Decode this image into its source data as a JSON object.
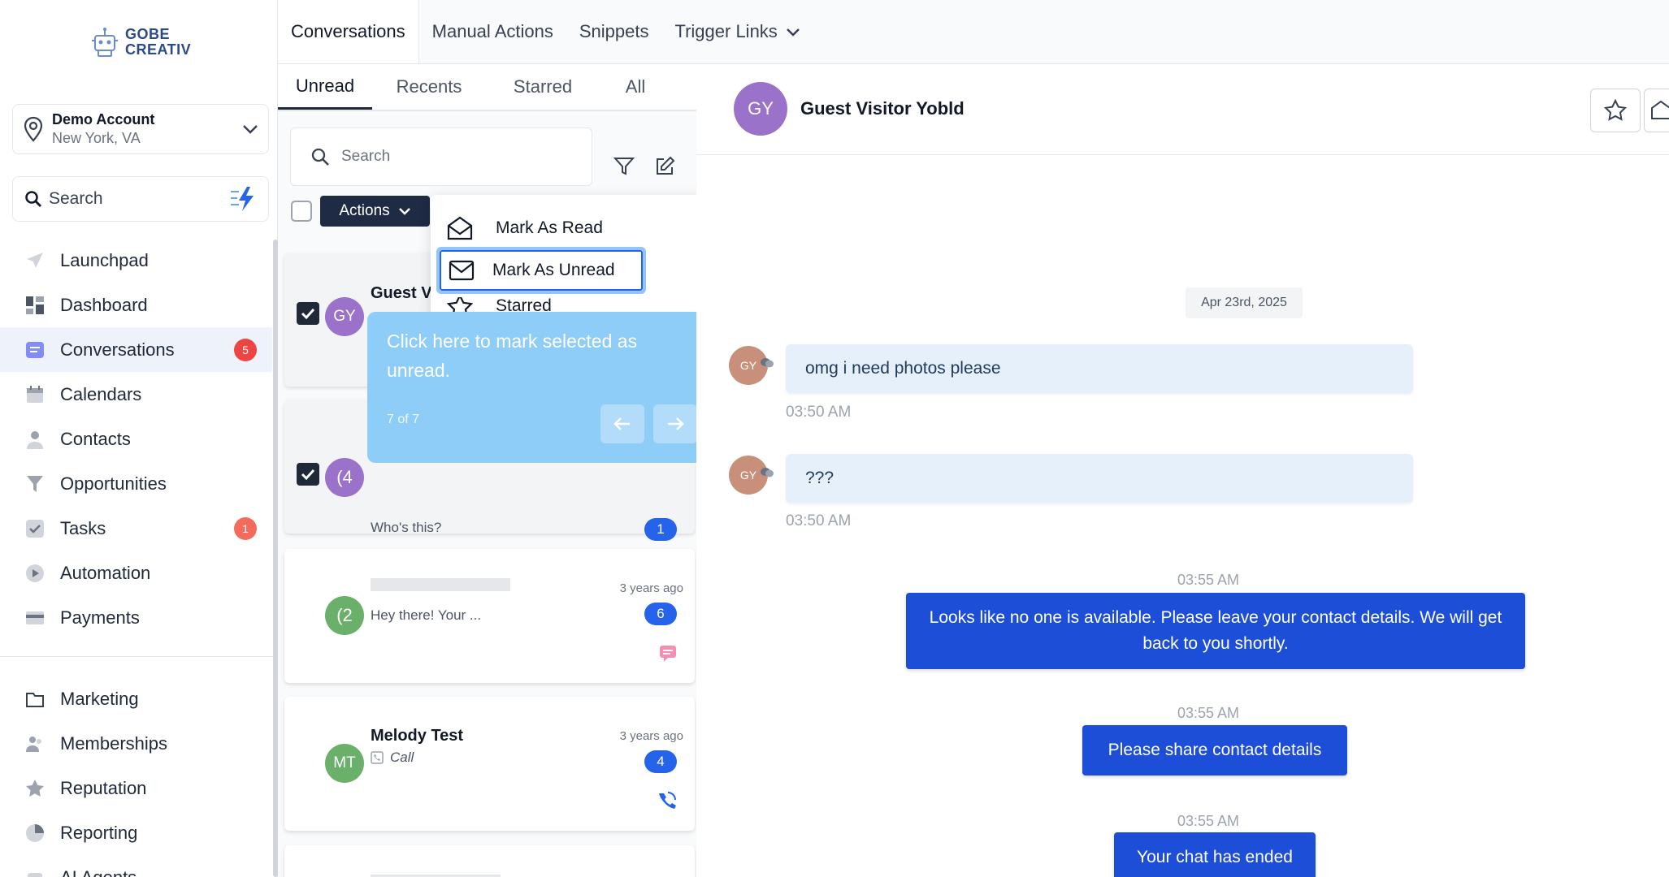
{
  "sidebar": {
    "logo": {
      "line1": "GOBE",
      "line2": "CREATIV"
    },
    "account": {
      "name": "Demo Account",
      "location": "New York, VA"
    },
    "search": {
      "placeholder": "Search"
    },
    "nav_primary": [
      {
        "label": "Launchpad",
        "icon": "rocket-icon"
      },
      {
        "label": "Dashboard",
        "icon": "dashboard-icon"
      },
      {
        "label": "Conversations",
        "icon": "chat-icon",
        "badge": "5",
        "active": true
      },
      {
        "label": "Calendars",
        "icon": "calendar-icon"
      },
      {
        "label": "Contacts",
        "icon": "person-icon"
      },
      {
        "label": "Opportunities",
        "icon": "filter-funnel-icon"
      },
      {
        "label": "Tasks",
        "icon": "check-icon",
        "badge": "1"
      },
      {
        "label": "Automation",
        "icon": "automation-icon"
      },
      {
        "label": "Payments",
        "icon": "card-icon"
      }
    ],
    "nav_secondary": [
      {
        "label": "Marketing",
        "icon": "folder-icon"
      },
      {
        "label": "Memberships",
        "icon": "people-icon"
      },
      {
        "label": "Reputation",
        "icon": "star-icon"
      },
      {
        "label": "Reporting",
        "icon": "pie-icon"
      },
      {
        "label": "AI Agents",
        "icon": "robot-icon"
      }
    ]
  },
  "topbar": {
    "tabs": [
      "Conversations",
      "Manual Actions",
      "Snippets",
      "Trigger Links"
    ]
  },
  "list": {
    "subtabs": [
      "Unread",
      "Recents",
      "Starred",
      "All"
    ],
    "search": {
      "placeholder": "Search"
    },
    "actions_label": "Actions",
    "cards": [
      {
        "initials": "GY",
        "name": "Guest V",
        "preview": "",
        "checked": true,
        "avatar_color": "#9b72c9"
      },
      {
        "initials": "(4",
        "name": "",
        "preview": "Who's this?",
        "count": "1",
        "checked": true,
        "avatar_color": "#9b72c9"
      },
      {
        "initials": "(2",
        "name": "",
        "preview": "Hey there! Your ...",
        "time": "3 years ago",
        "count": "6",
        "avatar_color": "#6ab06a"
      },
      {
        "initials": "MT",
        "name": "Melody Test",
        "preview": "Call",
        "time": "3 years ago",
        "count": "4",
        "avatar_color": "#6ab06a"
      }
    ]
  },
  "dropdown": {
    "items": [
      "Mark As Read",
      "Mark As Unread",
      "Starred"
    ]
  },
  "tooltip": {
    "text": "Click here to mark selected as unread.",
    "step": "7 of 7"
  },
  "chat": {
    "contact": {
      "initials": "GY",
      "name": "Guest Visitor Yobld",
      "avatar_color": "#9b72c9"
    },
    "date": "Apr 23rd, 2025",
    "incoming": [
      {
        "initials": "GY",
        "text": "omg i need photos please",
        "time": "03:50 AM"
      },
      {
        "initials": "GY",
        "text": "???",
        "time": "03:50 AM"
      }
    ],
    "outgoing": [
      {
        "time": "03:55 AM",
        "text": "Looks like no one is available. Please leave your contact details. We will get back to you shortly."
      },
      {
        "time": "03:55 AM",
        "text": "Please share contact details"
      },
      {
        "time": "03:55 AM",
        "text": "Your chat has ended"
      }
    ]
  },
  "colors": {
    "accent": "#1d4ed8",
    "badge_red": "#ef4444",
    "tooltip": "#8ecdf7",
    "active_nav_bg": "#eef2fb"
  }
}
